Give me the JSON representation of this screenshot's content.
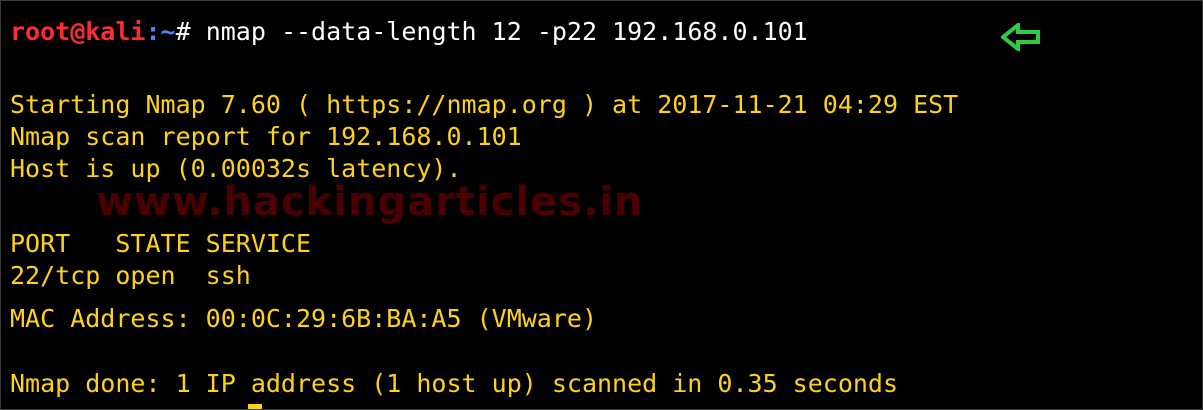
{
  "terminal": {
    "prompt_user_host": "root@kali",
    "prompt_path": ":~",
    "prompt_symbol": "# ",
    "command": "nmap --data-length 12 -p22 192.168.0.101",
    "output": {
      "start_line": "Starting Nmap 7.60 ( https://nmap.org ) at 2017-11-21 04:29 EST",
      "report_line": "Nmap scan report for 192.168.0.101",
      "host_line": "Host is up (0.00032s latency).",
      "port_header": "PORT   STATE SERVICE",
      "port_row": "22/tcp open  ssh",
      "mac_line": "MAC Address: 00:0C:29:6B:BA:A5 (VMware)",
      "done_line": "Nmap done: 1 IP address (1 host up) scanned in 0.35 seconds"
    },
    "watermark": "www.hackingarticles.in",
    "arrow_icon": "left-arrow-icon",
    "colors": {
      "background": "#000000",
      "output_text": "#ffd21a",
      "prompt_user": "#ff2d2d",
      "prompt_path": "#4d7fff",
      "command_text": "#ffffff",
      "arrow": "#2ecc40",
      "watermark": "#4a0000"
    }
  }
}
